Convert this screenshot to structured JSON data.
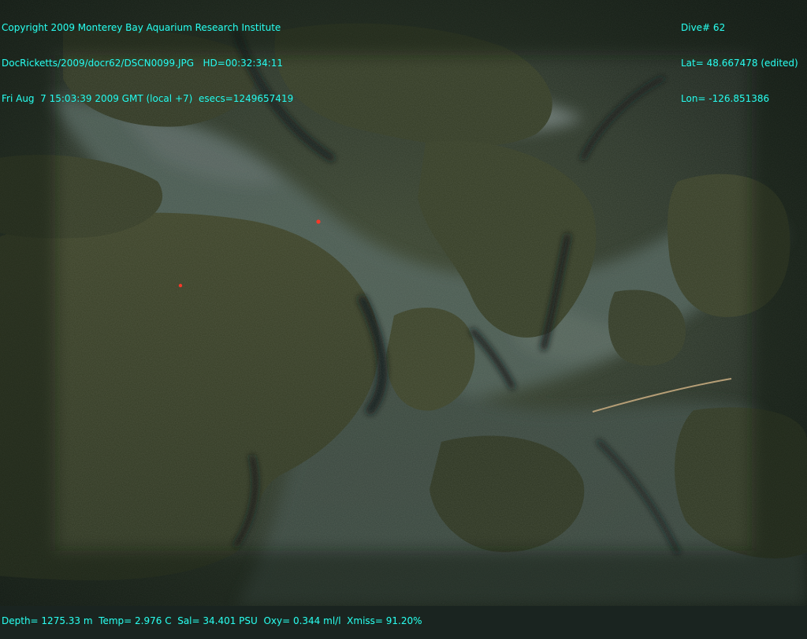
{
  "overlay": {
    "top_left": [
      "Copyright 2009 Monterey Bay Aquarium Research Institute",
      "DocRicketts/2009/docr62/DSCN0099.JPG   HD=00:32:34:11",
      "Fri Aug  7 15:03:39 2009 GMT (local +7)  esecs=1249657419"
    ],
    "top_right": [
      "Dive# 62",
      "Lat= 48.667478 (edited)",
      "Lon= -126.851386"
    ],
    "bottom": "Depth= 1275.33 m  Temp= 2.976 C  Sal= 34.401 PSU  Oxy= 0.344 ml/l  Xmiss= 91.20%",
    "text_color": "#2ff3f3"
  },
  "scene": {
    "laser_color": "#ff2a1a"
  }
}
